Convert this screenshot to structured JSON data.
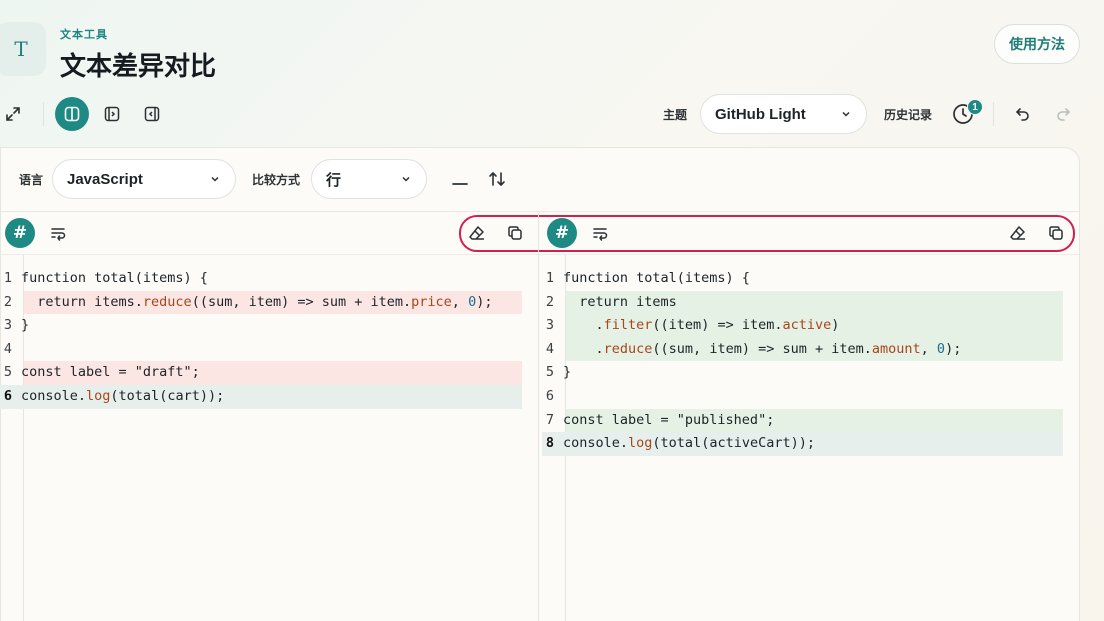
{
  "header": {
    "eyebrow": "文本工具",
    "title": "文本差异对比",
    "logo_glyph": "T",
    "help_label": "使用方法"
  },
  "toolbar": {
    "icons": [
      "expand-icon",
      "split-view-icon",
      "panel-right-icon",
      "panel-left-icon"
    ],
    "theme_label": "主题",
    "theme_value": "GitHub Light",
    "history_label": "历史记录",
    "history_badge": "1"
  },
  "options": {
    "language_label": "语言",
    "language_value": "JavaScript",
    "compare_label": "比较方式",
    "compare_value": "行"
  },
  "editor_toolbar": {
    "hash_glyph": "#"
  },
  "left_pane": {
    "lines": [
      {
        "num": "1",
        "state": "normal"
      },
      {
        "num": "2",
        "state": "del"
      },
      {
        "num": "3",
        "state": "normal"
      },
      {
        "num": "4",
        "state": "normal"
      },
      {
        "num": "5",
        "state": "del"
      },
      {
        "num": "6",
        "state": "cur"
      }
    ]
  },
  "right_pane": {
    "lines": [
      {
        "num": "1",
        "state": "normal"
      },
      {
        "num": "2",
        "state": "add"
      },
      {
        "num": "3",
        "state": "add"
      },
      {
        "num": "4",
        "state": "add"
      },
      {
        "num": "5",
        "state": "normal"
      },
      {
        "num": "6",
        "state": "normal"
      },
      {
        "num": "7",
        "state": "add"
      },
      {
        "num": "8",
        "state": "cur"
      }
    ]
  },
  "code": {
    "left": [
      [
        {
          "t": "function total(items) {"
        }
      ],
      [
        {
          "t": "  return items."
        },
        {
          "t": "reduce",
          "c": "fn"
        },
        {
          "t": "((sum, item) => sum + item."
        },
        {
          "t": "price",
          "c": "fn"
        },
        {
          "t": ", "
        },
        {
          "t": "0",
          "c": "num-tok"
        },
        {
          "t": ");"
        }
      ],
      [
        {
          "t": "}"
        }
      ],
      [
        {
          "t": ""
        }
      ],
      [
        {
          "t": "const label = \"draft\";"
        }
      ],
      [
        {
          "t": "console."
        },
        {
          "t": "log",
          "c": "fn"
        },
        {
          "t": "(total(cart));"
        }
      ]
    ],
    "right": [
      [
        {
          "t": "function total(items) {"
        }
      ],
      [
        {
          "t": "  return items"
        }
      ],
      [
        {
          "t": "    ."
        },
        {
          "t": "filter",
          "c": "fn"
        },
        {
          "t": "((item) => item."
        },
        {
          "t": "active",
          "c": "fn"
        },
        {
          "t": ")"
        }
      ],
      [
        {
          "t": "    ."
        },
        {
          "t": "reduce",
          "c": "fn"
        },
        {
          "t": "((sum, item) => sum + item."
        },
        {
          "t": "amount",
          "c": "fn"
        },
        {
          "t": ", "
        },
        {
          "t": "0",
          "c": "num-tok"
        },
        {
          "t": ");"
        }
      ],
      [
        {
          "t": "}"
        }
      ],
      [
        {
          "t": ""
        }
      ],
      [
        {
          "t": "const label = \"published\";"
        }
      ],
      [
        {
          "t": "console."
        },
        {
          "t": "log",
          "c": "fn"
        },
        {
          "t": "(total(activeCart));"
        }
      ]
    ]
  },
  "colors": {
    "accent": "#1f8a84",
    "deleted_bg": "#fbe6e4",
    "added_bg": "#e6f1e6",
    "highlight_border": "#d11f4f"
  }
}
